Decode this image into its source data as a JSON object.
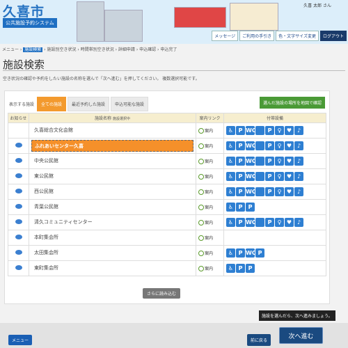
{
  "header": {
    "title": "久喜市",
    "subtitle": "公共施設予約システム",
    "user": "久喜 太郎 さん",
    "tools": [
      "メッセージ",
      "ご利用の手引き",
      "色・文字サイズ変更",
      "ログアウト"
    ]
  },
  "breadcrumb": {
    "pre": "メニュー ›",
    "current": "施設検索",
    "steps": "› 施設別空き状況 › 時間帯別空き状況 › 詳細申請 › 申込確認 › 申込完了"
  },
  "page": {
    "title": "施設検索",
    "description": "空き状況の確認や予約をしたい施設の名称を選んで「次へ進む」を押してください。 複数選択可能です。"
  },
  "filter": {
    "label": "表示する施設",
    "tabs": [
      "全ての施設",
      "最近予約した施設",
      "申込可能な施設"
    ],
    "active": 0,
    "map_button": "選んだ施設の場所を地図で確認"
  },
  "table": {
    "headers": {
      "notice": "お知らせ",
      "name": "施設名称",
      "name_note": "施設選択中",
      "guide": "案内リンク",
      "equipment": "付帯設備"
    },
    "guide_label": "案内",
    "rows": [
      {
        "name": "久喜総合文化会館",
        "notice": false,
        "selected": false,
        "icons": [
          "wheelchair",
          "parking-wc",
          "toilet",
          "elevator",
          "parking",
          "baby",
          "nursing",
          "hearing"
        ]
      },
      {
        "name": "ふれあいセンター久喜",
        "notice": true,
        "selected": true,
        "icons": [
          "wheelchair",
          "parking-wc",
          "toilet",
          "elevator",
          "parking",
          "baby",
          "nursing",
          "hearing"
        ]
      },
      {
        "name": "中央公民館",
        "notice": true,
        "selected": false,
        "icons": [
          "wheelchair",
          "parking-wc",
          "toilet",
          "elevator",
          "parking",
          "baby",
          "nursing",
          "hearing"
        ]
      },
      {
        "name": "東公民館",
        "notice": true,
        "selected": false,
        "icons": [
          "wheelchair",
          "parking-wc",
          "toilet",
          "elevator",
          "parking",
          "baby",
          "nursing",
          "hearing"
        ]
      },
      {
        "name": "西公民館",
        "notice": true,
        "selected": false,
        "icons": [
          "wheelchair",
          "parking-wc",
          "toilet",
          "elevator",
          "parking",
          "baby",
          "nursing",
          "hearing"
        ]
      },
      {
        "name": "青葉公民館",
        "notice": true,
        "selected": false,
        "icons": [
          "wheelchair",
          "parking-wc",
          "parking"
        ]
      },
      {
        "name": "清久コミュニティセンター",
        "notice": true,
        "selected": false,
        "icons": [
          "wheelchair",
          "parking-wc",
          "toilet",
          "elevator",
          "parking",
          "baby",
          "nursing",
          "hearing"
        ]
      },
      {
        "name": "本町集会所",
        "notice": true,
        "selected": false,
        "icons": []
      },
      {
        "name": "太田集会所",
        "notice": true,
        "selected": false,
        "icons": [
          "wheelchair",
          "parking-wc",
          "toilet",
          "parking"
        ]
      },
      {
        "name": "東町集会所",
        "notice": true,
        "selected": false,
        "icons": [
          "wheelchair",
          "parking-wc",
          "parking"
        ]
      }
    ]
  },
  "more_button": "さらに読み込む",
  "footer": {
    "menu": "メニュー",
    "back": "前に戻る",
    "next": "次へ進む",
    "tooltip": "施設を選んだら、次へ進みましょう。"
  },
  "colors": {
    "accent": "#f39a2e",
    "primary": "#1f6fc2",
    "icon": "#2e7fd2"
  }
}
